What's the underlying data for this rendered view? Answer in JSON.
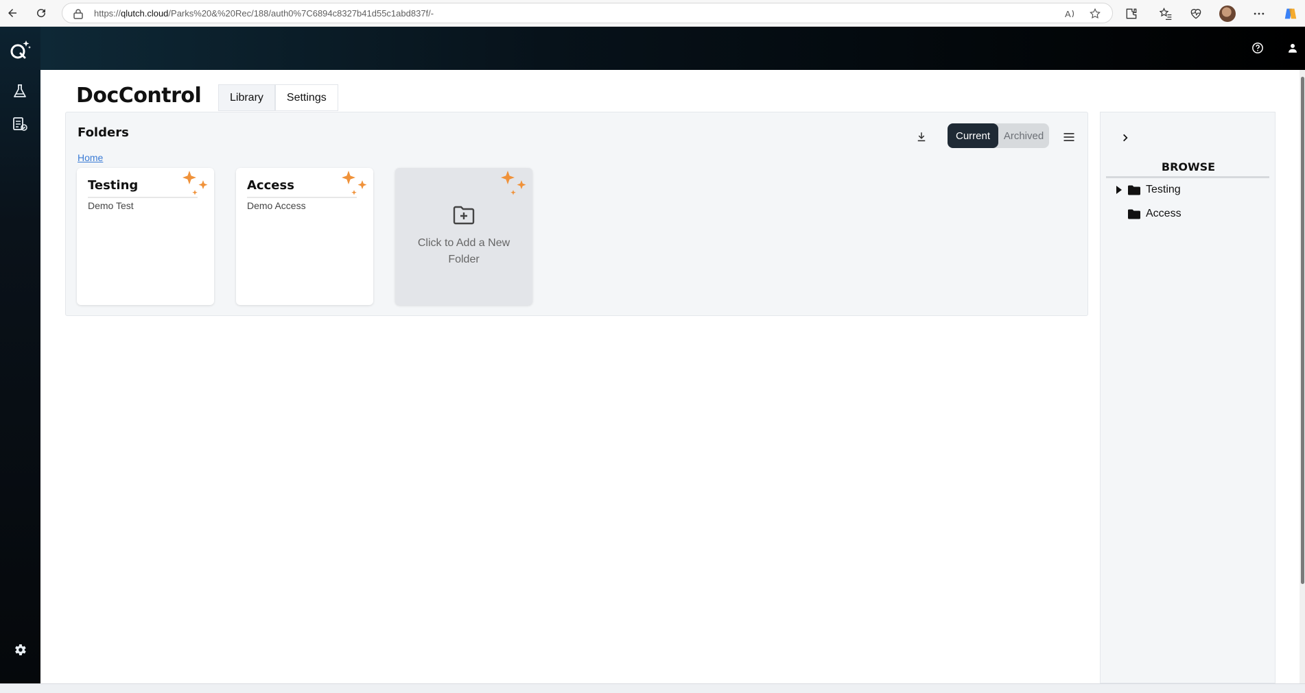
{
  "browser": {
    "url_prefix": "https://",
    "url_domain": "qlutch.cloud",
    "url_path": "/Parks%20&%20Rec/188/auth0%7C6894c8327b41d55c1abd837f/-"
  },
  "app": {
    "title": "DocControl",
    "tabs": [
      {
        "label": "Library",
        "active": true
      },
      {
        "label": "Settings",
        "active": false
      }
    ]
  },
  "folders": {
    "heading": "Folders",
    "breadcrumb": "Home",
    "toggle": {
      "current": "Current",
      "archived": "Archived",
      "selected": "Current"
    },
    "cards": [
      {
        "title": "Testing",
        "description": "Demo Test"
      },
      {
        "title": "Access",
        "description": "Demo Access"
      }
    ],
    "add_card": {
      "line1": "Click to Add a New",
      "line2": "Folder"
    }
  },
  "browse": {
    "title": "BROWSE",
    "items": [
      {
        "label": "Testing",
        "expandable": true
      },
      {
        "label": "Access",
        "expandable": false
      }
    ]
  },
  "colors": {
    "accent_orange": "#f0923a",
    "toggle_active": "#1f2a35",
    "link_blue": "#3a7bd5"
  }
}
